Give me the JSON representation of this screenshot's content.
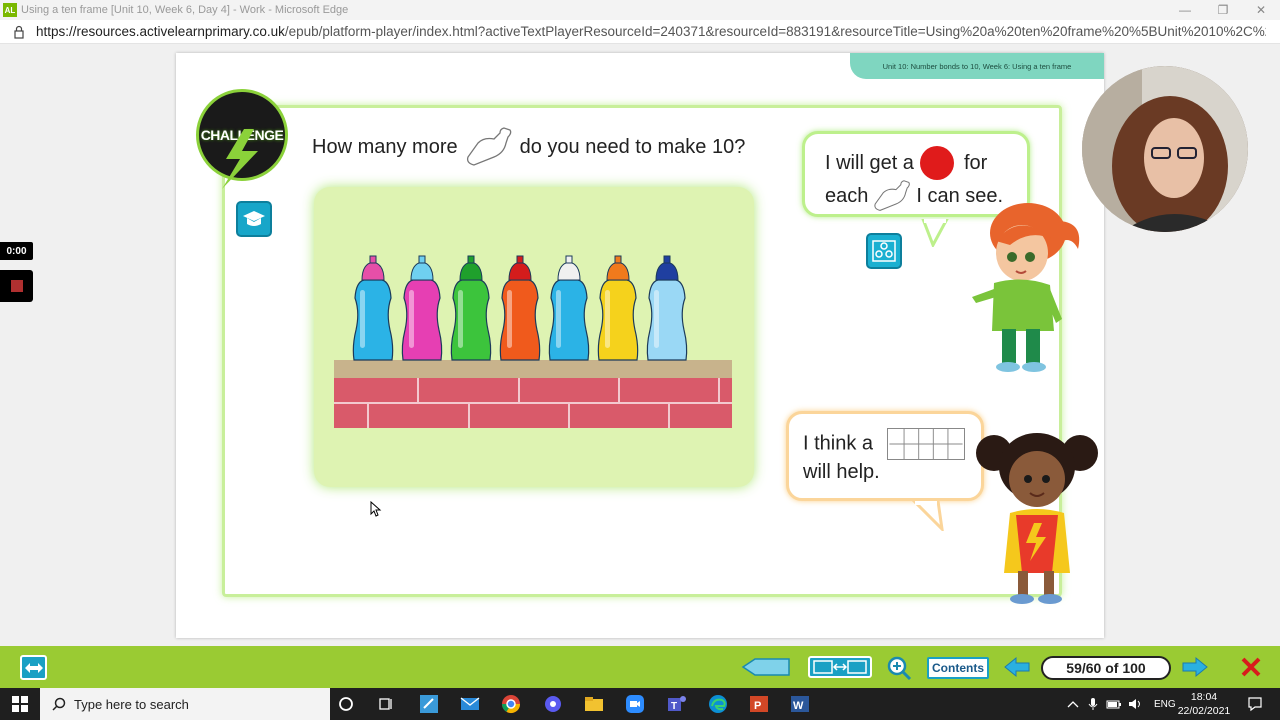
{
  "browser": {
    "app_icon_label": "AL",
    "window_title": "Using a ten frame [Unit 10, Week 6, Day 4] - Work - Microsoft Edge",
    "url_domain": "https://resources.activelearnprimary.co.uk",
    "url_rest": "/epub/platform-player/index.html?activeTextPlayerResourceId=240371&resourceId=883191&resourceTitle=Using%20a%20ten%20frame%20%5BUnit%2010%2C%20..."
  },
  "recorder": {
    "timer": "0:00"
  },
  "lesson": {
    "unit_tab": "Unit 10: Number bonds to 10, Week 6: Using a ten frame",
    "challenge_badge": "CHALLENGE",
    "question_prefix": "How many more",
    "question_suffix": "do you need to make 10?",
    "bubble1_line1a": "I will get a",
    "bubble1_line1b": "for",
    "bubble1_line2a": "each",
    "bubble1_line2b": "I can see.",
    "bubble2_line1": "I think a",
    "bubble2_line2": "will help.",
    "bottle_colors": [
      "#2bb3e6",
      "#e63fb3",
      "#3cc43c",
      "#f05a1c",
      "#2bb3e6",
      "#f5d21c",
      "#9ad8f5"
    ],
    "bottle_cap_colors": [
      "#e64fa8",
      "#6fd0f0",
      "#1fa02c",
      "#d41c1c",
      "#f0f0f0",
      "#f07a1c",
      "#1f3fa0"
    ],
    "bottle_count": 7
  },
  "toolbar": {
    "contents_label": "Contents",
    "page_counter": "59/60 of 100"
  },
  "taskbar": {
    "search_placeholder": "Type here to search",
    "lang": "ENG",
    "time": "18:04",
    "date": "22/02/2021"
  },
  "colors": {
    "toolbar_green": "#9acb33",
    "frame_green": "#c8ef9a",
    "panel_green": "#def3b2",
    "accent_blue": "#1aa0c4"
  }
}
